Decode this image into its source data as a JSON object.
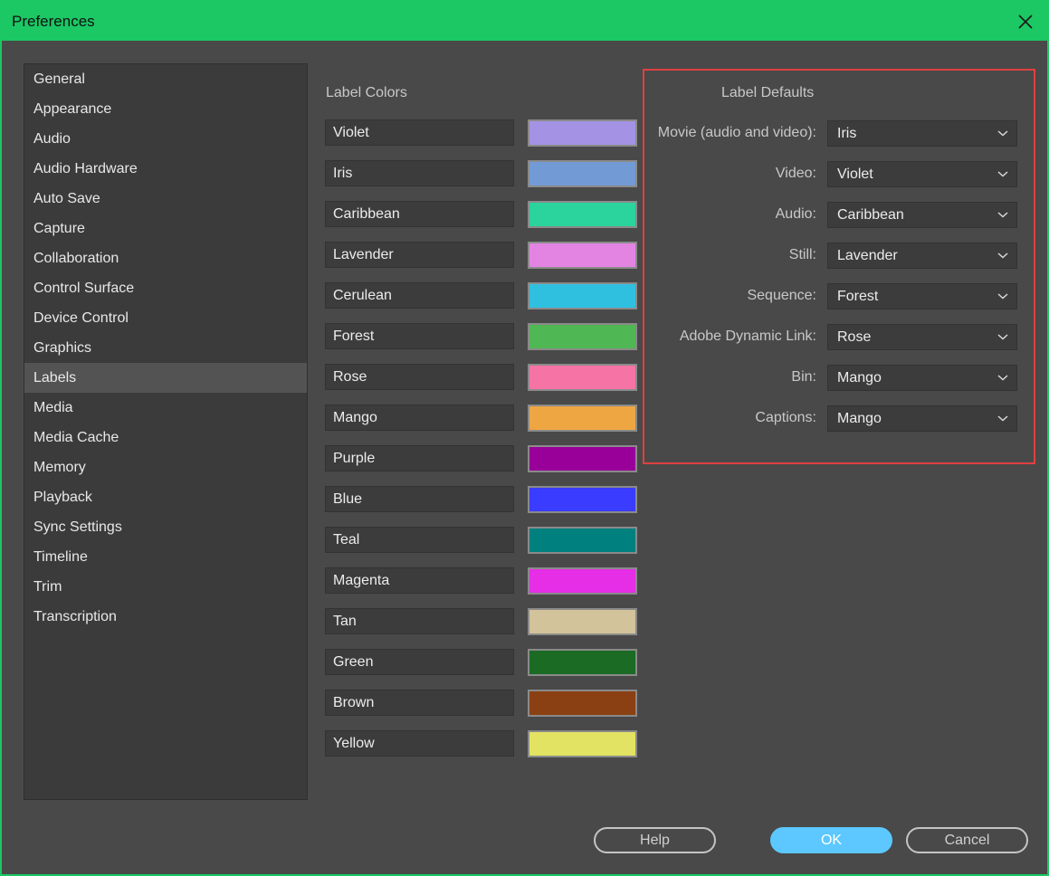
{
  "window": {
    "title": "Preferences"
  },
  "sidebar": {
    "items": [
      {
        "label": "General"
      },
      {
        "label": "Appearance"
      },
      {
        "label": "Audio"
      },
      {
        "label": "Audio Hardware"
      },
      {
        "label": "Auto Save"
      },
      {
        "label": "Capture"
      },
      {
        "label": "Collaboration"
      },
      {
        "label": "Control Surface"
      },
      {
        "label": "Device Control"
      },
      {
        "label": "Graphics"
      },
      {
        "label": "Labels",
        "selected": true
      },
      {
        "label": "Media"
      },
      {
        "label": "Media Cache"
      },
      {
        "label": "Memory"
      },
      {
        "label": "Playback"
      },
      {
        "label": "Sync Settings"
      },
      {
        "label": "Timeline"
      },
      {
        "label": "Trim"
      },
      {
        "label": "Transcription"
      }
    ]
  },
  "label_colors": {
    "title": "Label Colors",
    "items": [
      {
        "name": "Violet",
        "color": "#a493e4"
      },
      {
        "name": "Iris",
        "color": "#729bd6"
      },
      {
        "name": "Caribbean",
        "color": "#2ad49c"
      },
      {
        "name": "Lavender",
        "color": "#e384e3"
      },
      {
        "name": "Cerulean",
        "color": "#2fc0e0"
      },
      {
        "name": "Forest",
        "color": "#4fb754"
      },
      {
        "name": "Rose",
        "color": "#f673a6"
      },
      {
        "name": "Mango",
        "color": "#eea643"
      },
      {
        "name": "Purple",
        "color": "#980099"
      },
      {
        "name": "Blue",
        "color": "#3a3cff"
      },
      {
        "name": "Teal",
        "color": "#018080"
      },
      {
        "name": "Magenta",
        "color": "#e52ee5"
      },
      {
        "name": "Tan",
        "color": "#d2c39b"
      },
      {
        "name": "Green",
        "color": "#1c6b25"
      },
      {
        "name": "Brown",
        "color": "#8a4012"
      },
      {
        "name": "Yellow",
        "color": "#e2e362"
      }
    ]
  },
  "label_defaults": {
    "title": "Label Defaults",
    "items": [
      {
        "label": "Movie (audio and video):",
        "value": "Iris"
      },
      {
        "label": "Video:",
        "value": "Violet"
      },
      {
        "label": "Audio:",
        "value": "Caribbean"
      },
      {
        "label": "Still:",
        "value": "Lavender"
      },
      {
        "label": "Sequence:",
        "value": "Forest"
      },
      {
        "label": "Adobe Dynamic Link:",
        "value": "Rose"
      },
      {
        "label": "Bin:",
        "value": "Mango"
      },
      {
        "label": "Captions:",
        "value": "Mango"
      }
    ]
  },
  "buttons": {
    "help": "Help",
    "ok": "OK",
    "cancel": "Cancel"
  },
  "colors": {
    "accent": "#5cc8ff",
    "titlebar": "#1bc864",
    "highlight_box": "#e04040"
  },
  "icons": {
    "close": "close-icon",
    "dropdown": "chevron-down-icon"
  }
}
